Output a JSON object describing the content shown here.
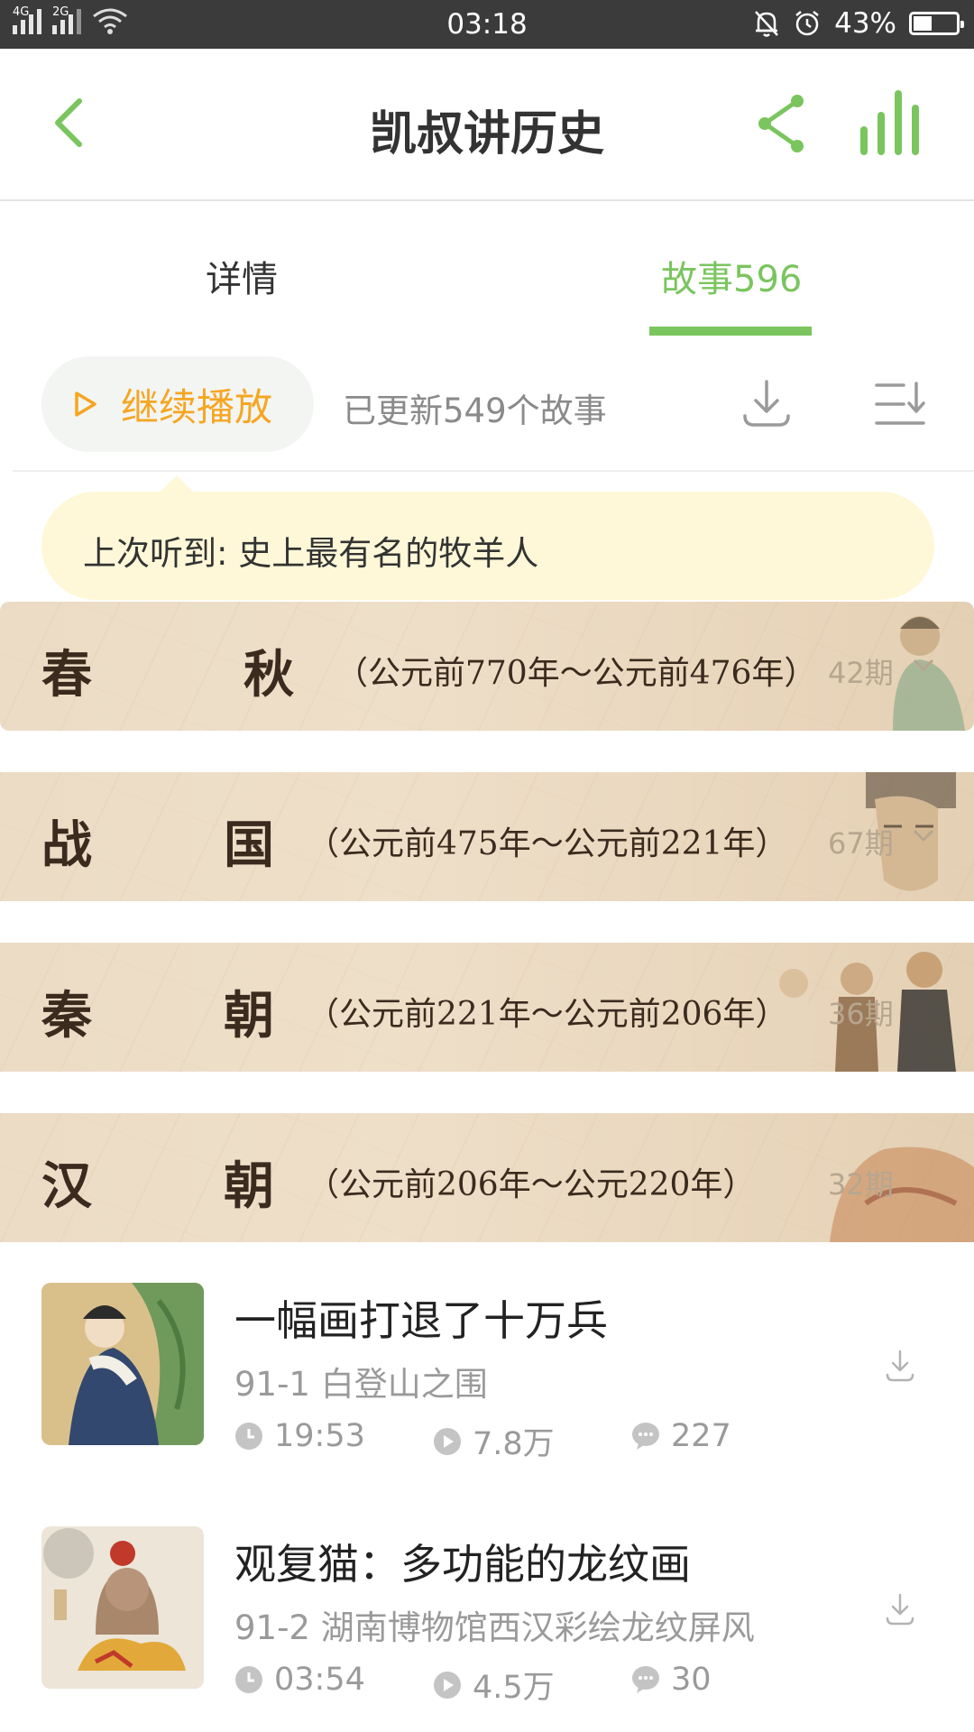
{
  "status_bar": {
    "net1": "4G",
    "net2": "2G",
    "time": "03:18",
    "battery": "43%"
  },
  "header": {
    "title": "凯叔讲历史"
  },
  "tabs": [
    {
      "label": "详情",
      "active": false
    },
    {
      "label": "故事596",
      "active": true
    }
  ],
  "actions": {
    "continue_label": "继续播放",
    "updated_text": "已更新549个故事"
  },
  "last_heard": "上次听到: 史上最有名的牧羊人",
  "eras": [
    {
      "c1": "春",
      "c2": "秋",
      "range": "（公元前770年～公元前476年）",
      "count": "42期"
    },
    {
      "c1": "战",
      "c2": "国",
      "range": "（公元前475年～公元前221年）",
      "count": "67期"
    },
    {
      "c1": "秦",
      "c2": "朝",
      "range": "（公元前221年～公元前206年）",
      "count": "36期"
    },
    {
      "c1": "汉",
      "c2": "朝",
      "range": "（公元前206年～公元220年）",
      "count": "32期"
    }
  ],
  "stories": [
    {
      "title": "一幅画打退了十万兵",
      "subtitle": "91-1 白登山之围",
      "duration": "19:53",
      "plays": "7.8万",
      "comments": "227"
    },
    {
      "title": "观复猫：多功能的龙纹画",
      "subtitle": "91-2 湖南博物馆西汉彩绘龙纹屏风",
      "duration": "03:54",
      "plays": "4.5万",
      "comments": "30"
    }
  ],
  "colors": {
    "accent": "#7ac55e",
    "play": "#f5a623",
    "bubble": "#fef8d8",
    "status_bar": "#3b3b3b"
  }
}
